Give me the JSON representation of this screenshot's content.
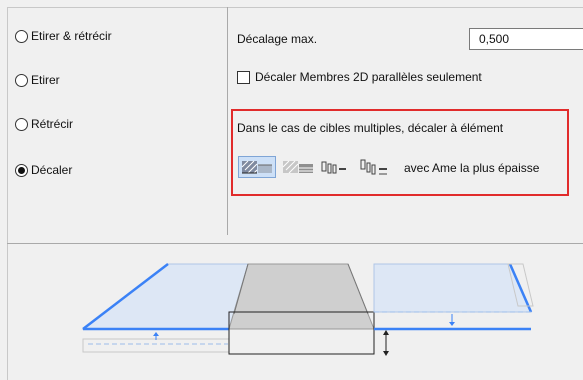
{
  "options": {
    "stretch_shrink": "Etirer & rétrécir",
    "stretch": "Etirer",
    "shrink": "Rétrécir",
    "offset": "Décaler",
    "selected": "Décaler"
  },
  "offset_max": {
    "label": "Décalage max.",
    "value": "0,500"
  },
  "checkbox": {
    "label": "Décaler Membres 2D parallèles seulement",
    "checked": false
  },
  "multiple_targets": {
    "heading": "Dans le cas de cibles multiples, décaler à élément",
    "suffix": "avec Ame la plus épaisse",
    "icons": [
      "thickest-core-top-icon",
      "thickest-core-bottom-icon",
      "thickest-core-right-icon",
      "thickest-core-left-icon"
    ],
    "selected_icon": 0
  },
  "colors": {
    "accent": "#3b82f6",
    "highlight": "#e12b2b"
  }
}
